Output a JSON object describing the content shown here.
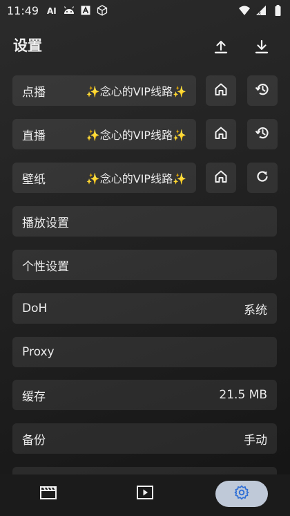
{
  "status_bar": {
    "time": "11:49",
    "left_icons": [
      "ai-icon",
      "android-icon",
      "a-box-icon",
      "cube-icon"
    ],
    "right_icons": [
      "wifi-icon",
      "signal-icon",
      "battery-icon"
    ]
  },
  "header": {
    "title": "设置",
    "upload_icon": "upload-icon",
    "download_icon": "download-icon"
  },
  "sources": [
    {
      "label": "点播",
      "site": "✨念心的VIP线路✨",
      "home_icon": "home-icon",
      "action_icon": "history-icon"
    },
    {
      "label": "直播",
      "site": "✨念心的VIP线路✨",
      "home_icon": "home-icon",
      "action_icon": "history-icon"
    },
    {
      "label": "壁纸",
      "site": "✨念心的VIP线路✨",
      "home_icon": "home-icon",
      "action_icon": "refresh-icon"
    }
  ],
  "settings": [
    {
      "label": "播放设置",
      "value": ""
    },
    {
      "label": "个性设置",
      "value": ""
    },
    {
      "label": "DoH",
      "value": "系统"
    },
    {
      "label": "Proxy",
      "value": ""
    },
    {
      "label": "缓存",
      "value": "21.5 MB"
    },
    {
      "label": "备份",
      "value": "手动"
    }
  ],
  "bottom_nav": {
    "items": [
      "film-icon",
      "play-icon",
      "settings-icon"
    ],
    "active": "settings-icon",
    "active_color": "#bfc9d8",
    "active_icon_color": "#2f6fd6"
  }
}
